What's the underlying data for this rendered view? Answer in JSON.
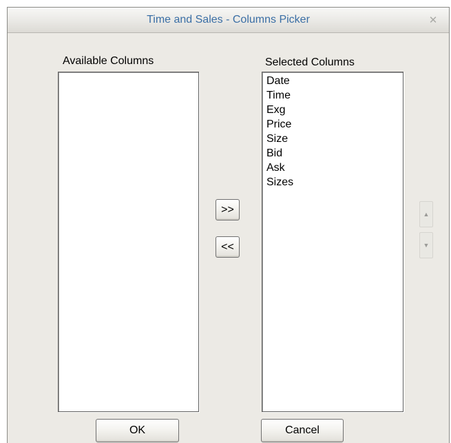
{
  "window": {
    "title": "Time and Sales - Columns Picker",
    "close_icon": "close-icon"
  },
  "available": {
    "label": "Available Columns",
    "items": []
  },
  "selected": {
    "label": "Selected Columns",
    "items": [
      "Date",
      "Time",
      "Exg",
      "Price",
      "Size",
      "Bid",
      "Ask",
      "Sizes"
    ]
  },
  "transfer": {
    "add_label": ">>",
    "remove_label": "<<"
  },
  "reorder": {
    "up_icon": "arrow-up-icon",
    "down_icon": "arrow-down-icon"
  },
  "buttons": {
    "ok_label": "OK",
    "cancel_label": "Cancel"
  }
}
